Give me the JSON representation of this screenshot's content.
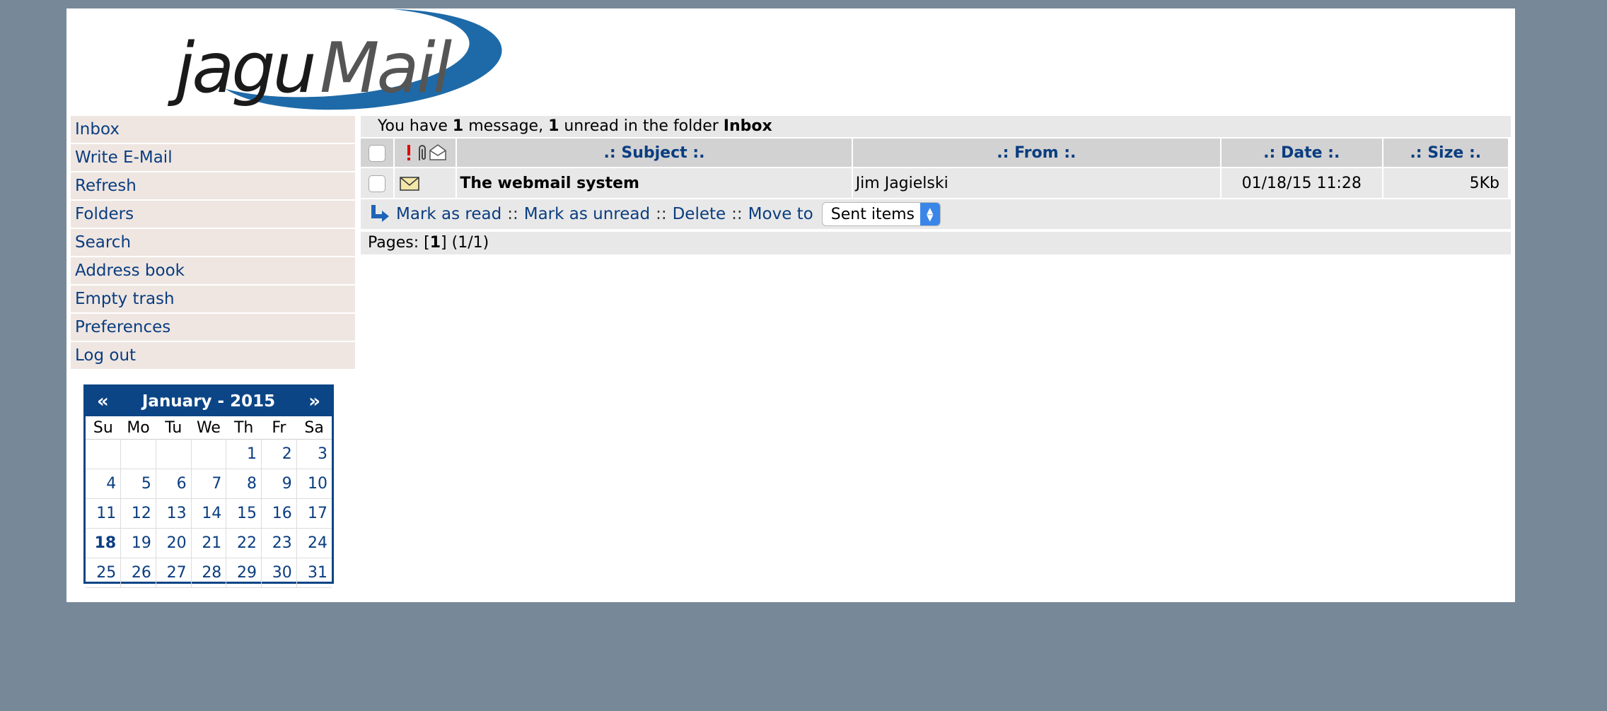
{
  "logo": {
    "text_part1": "jagu",
    "text_part2": "Mail"
  },
  "nav": {
    "items": [
      {
        "label": "Inbox"
      },
      {
        "label": "Write E-Mail"
      },
      {
        "label": "Refresh"
      },
      {
        "label": "Folders"
      },
      {
        "label": "Search"
      },
      {
        "label": "Address book"
      },
      {
        "label": "Empty trash"
      },
      {
        "label": "Preferences"
      },
      {
        "label": "Log out"
      }
    ]
  },
  "calendar": {
    "prev": "«",
    "next": "»",
    "title": "January - 2015",
    "weekdays": [
      "Su",
      "Mo",
      "Tu",
      "We",
      "Th",
      "Fr",
      "Sa"
    ],
    "weeks": [
      [
        "",
        "",
        "",
        "",
        "1",
        "2",
        "3"
      ],
      [
        "4",
        "5",
        "6",
        "7",
        "8",
        "9",
        "10"
      ],
      [
        "11",
        "12",
        "13",
        "14",
        "15",
        "16",
        "17"
      ],
      [
        "18",
        "19",
        "20",
        "21",
        "22",
        "23",
        "24"
      ],
      [
        "25",
        "26",
        "27",
        "28",
        "29",
        "30",
        "31"
      ]
    ],
    "today": "18"
  },
  "summary": {
    "p1": "You have ",
    "count": "1",
    "p2": " message, ",
    "unread": "1",
    "p3": " unread in the folder ",
    "folder": "Inbox"
  },
  "table": {
    "columns": {
      "subject": ".: Subject :.",
      "from": ".: From :.",
      "date": ".: Date :.",
      "size": ".: Size :."
    },
    "rows": [
      {
        "subject": "The webmail system",
        "from": "Jim Jagielski",
        "date": "01/18/15 11:28",
        "size": "5Kb"
      }
    ]
  },
  "actions": {
    "mark_read": "Mark as read",
    "mark_unread": "Mark as unread",
    "delete": "Delete",
    "move_to": "Move to",
    "separator": "::",
    "move_target": "Sent items"
  },
  "pages": {
    "prefix": "Pages: [",
    "current": "1",
    "suffix": "] (1/1)"
  },
  "colors": {
    "background": "#778899",
    "link": "#0a3d80",
    "calendar": "#0b4585"
  }
}
